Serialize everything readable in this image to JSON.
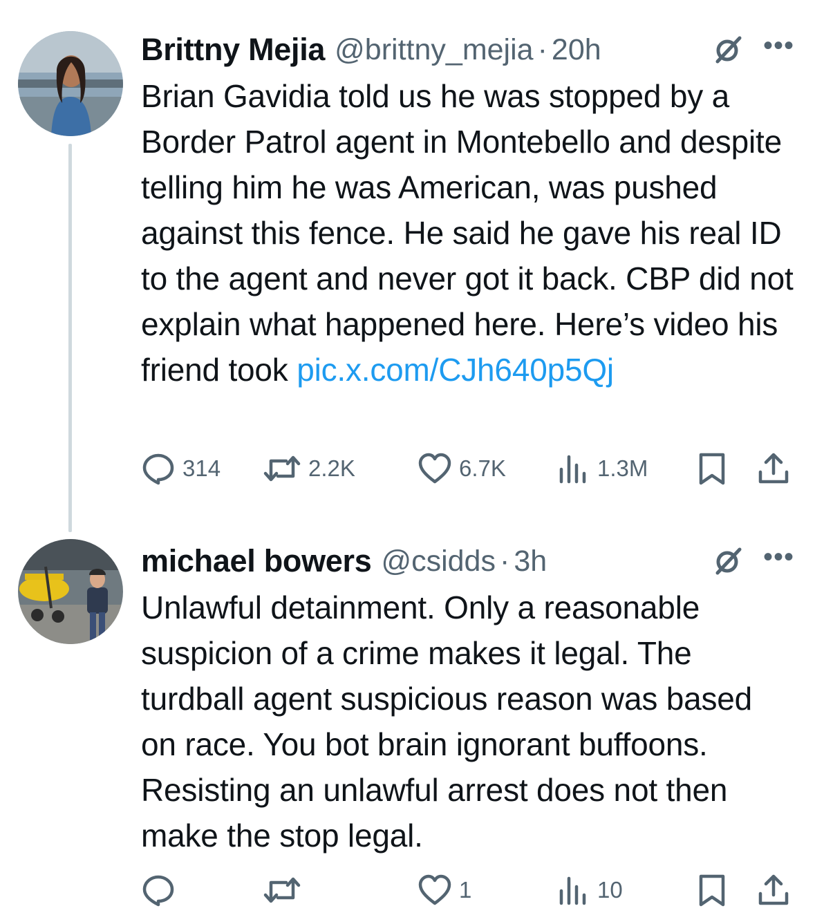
{
  "tweets": [
    {
      "author": {
        "name": "Brittny Mejia",
        "handle": "@brittny_mejia"
      },
      "separator": "·",
      "time": "20h",
      "text": "Brian Gavidia told us he was stopped by a Border Patrol agent in Montebello and despite telling him he was American, was pushed against this fence. He said he gave his real ID to the agent and never got it back. CBP did not explain what happened here. Here’s video his friend took ",
      "link": "pic.x.com/CJh640p5Qj",
      "stats": {
        "replies": "314",
        "reposts": "2.2K",
        "likes": "6.7K",
        "views": "1.3M"
      }
    },
    {
      "author": {
        "name": "michael bowers",
        "handle": "@csidds"
      },
      "separator": "·",
      "time": "3h",
      "text": "Unlawful detainment. Only a reasonable suspicion of a crime makes it legal. The turdball agent suspicious reason was based on race. You bot brain ignorant buffoons. Resisting an unlawful arrest does not then make the stop legal.",
      "link": "",
      "stats": {
        "replies": "",
        "reposts": "",
        "likes": "1",
        "views": "10"
      }
    }
  ],
  "icons": {
    "reply": "reply-icon",
    "repost": "repost-icon",
    "like": "heart-icon",
    "views": "views-icon",
    "bookmark": "bookmark-icon",
    "share": "share-icon",
    "grok": "grok-icon",
    "more": "more-icon"
  },
  "colors": {
    "text": "#0f1419",
    "secondary": "#536471",
    "link": "#1d9bf0",
    "thread": "#cfd9de"
  }
}
